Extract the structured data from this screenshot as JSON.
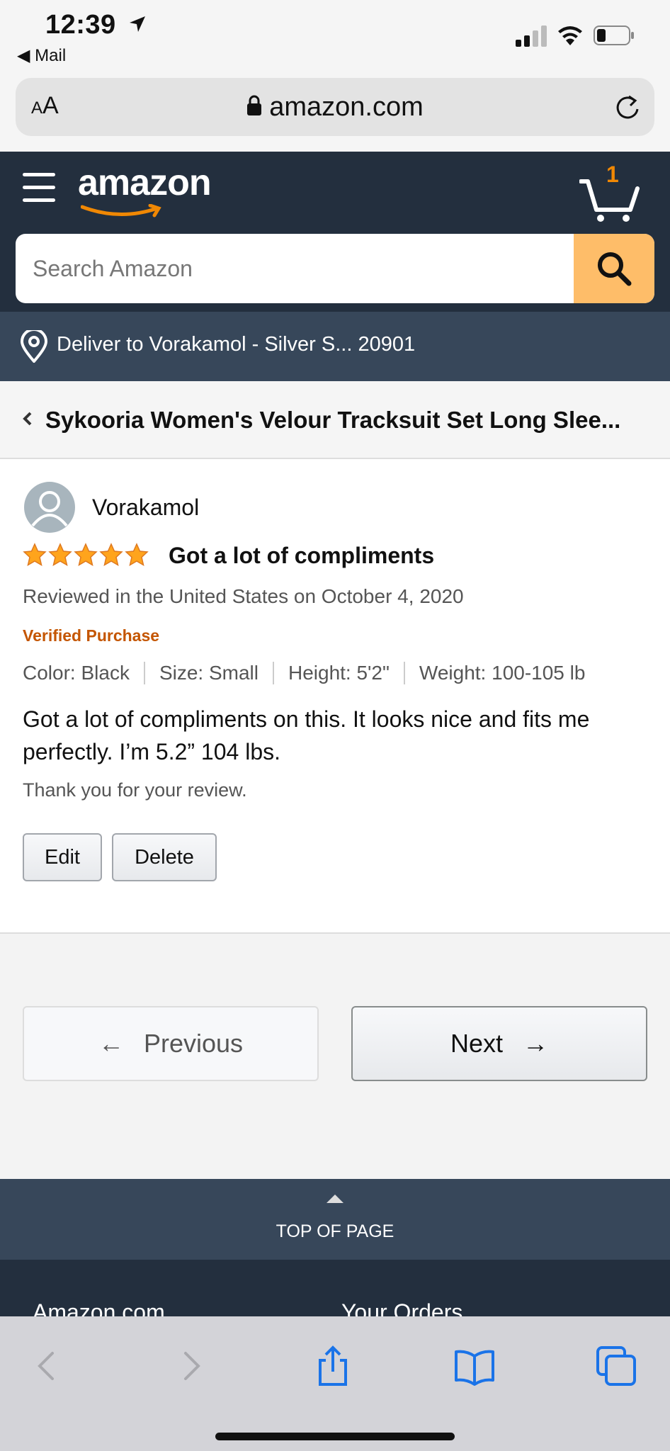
{
  "status_bar": {
    "time": "12:39",
    "back_app": "Mail"
  },
  "browser": {
    "text_size_label_small": "A",
    "text_size_label_large": "A",
    "url": "amazon.com"
  },
  "header": {
    "logo_text": "amazon",
    "cart_count": "1",
    "search_placeholder": "Search Amazon",
    "brand_color": "#232f3e",
    "accent_color": "#febd69"
  },
  "deliver": {
    "text": "Deliver to Vorakamol - Silver S... 20901"
  },
  "product": {
    "title": "Sykooria Women's Velour Tracksuit Set Long Slee..."
  },
  "review": {
    "reviewer": "Vorakamol",
    "rating": 5,
    "rating_max": 5,
    "title": "Got a lot of compliments",
    "date": "Reviewed in the United States on October 4, 2020",
    "verified": "Verified Purchase",
    "attributes": [
      "Color: Black",
      "Size: Small",
      "Height: 5'2\"",
      "Weight: 100-105 lb"
    ],
    "body": "Got a lot of compliments on this. It looks nice and fits me perfectly. I’m 5.2” 104 lbs.",
    "thanks": "Thank you for your review.",
    "edit_label": "Edit",
    "delete_label": "Delete"
  },
  "pagination": {
    "previous_label": "Previous",
    "next_label": "Next",
    "previous_arrow": "←",
    "next_arrow": "→"
  },
  "top_of_page": {
    "label": "TOP OF PAGE"
  },
  "footer": {
    "col1": "Amazon.com",
    "col2": "Your Orders"
  },
  "icons": {
    "toolbar": [
      "back-icon",
      "forward-icon",
      "share-icon",
      "bookmarks-icon",
      "tabs-icon"
    ]
  }
}
